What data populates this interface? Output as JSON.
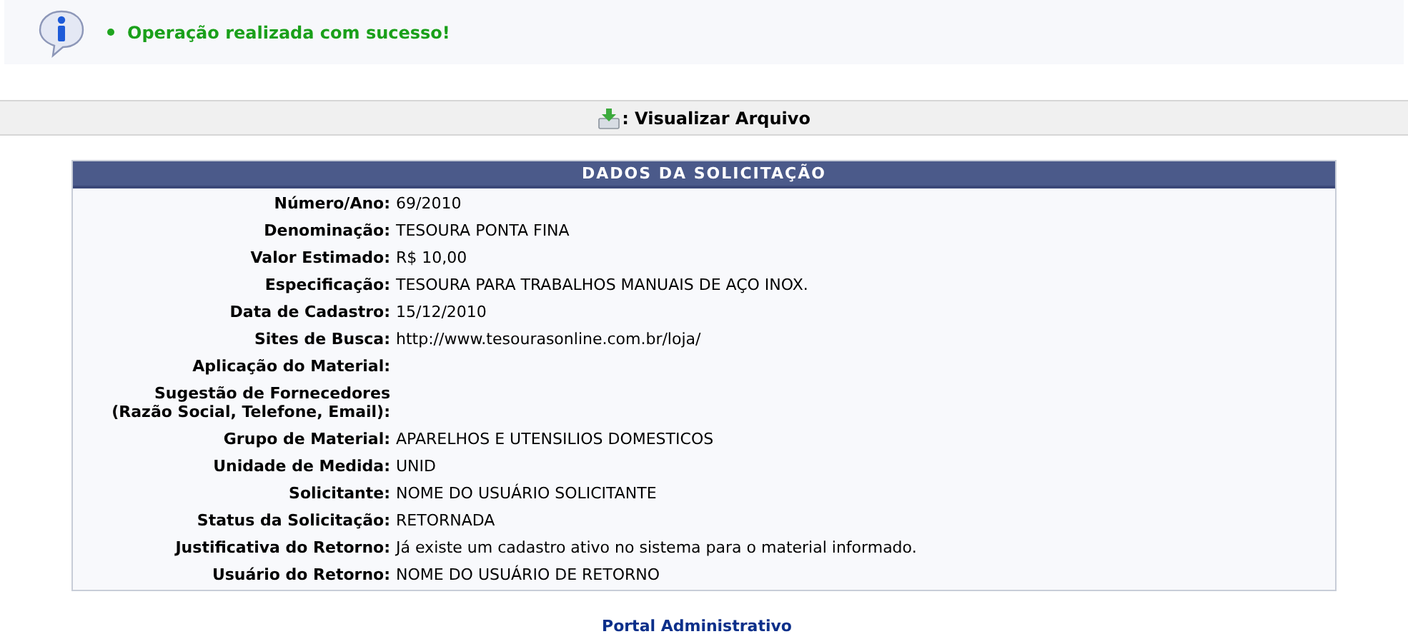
{
  "message": {
    "text": "Operação realizada com sucesso!"
  },
  "toolbar": {
    "action": ": Visualizar Arquivo"
  },
  "panel": {
    "title": "DADOS DA SOLICITAÇÃO",
    "rows": [
      {
        "label": "Número/Ano:",
        "value": "69/2010"
      },
      {
        "label": "Denominação:",
        "value": "TESOURA PONTA FINA"
      },
      {
        "label": "Valor Estimado:",
        "value": "R$ 10,00"
      },
      {
        "label": "Especificação:",
        "value": "TESOURA PARA TRABALHOS MANUAIS DE AÇO INOX."
      },
      {
        "label": "Data de Cadastro:",
        "value": "15/12/2010"
      },
      {
        "label": "Sites de Busca:",
        "value": "http://www.tesourasonline.com.br/loja/"
      },
      {
        "label": "Aplicação do Material:"
      },
      {
        "label": "Sugestão de Fornecedores\n(Razão Social, Telefone, Email):"
      },
      {
        "label": "Grupo de Material:",
        "value": "APARELHOS E UTENSILIOS DOMESTICOS"
      },
      {
        "label": "Unidade de Medida:",
        "value": "UNID"
      },
      {
        "label": "Solicitante:",
        "value": "NOME DO USUÁRIO SOLICITANTE"
      },
      {
        "label": "Status da Solicitação:",
        "value": "RETORNADA"
      },
      {
        "label": "Justificativa do Retorno:",
        "value": "Já existe um cadastro ativo no sistema para o material informado."
      },
      {
        "label": "Usuário do Retorno:",
        "value": "NOME DO USUÁRIO DE RETORNO"
      }
    ]
  },
  "footer_link": "Portal Administrativo"
}
